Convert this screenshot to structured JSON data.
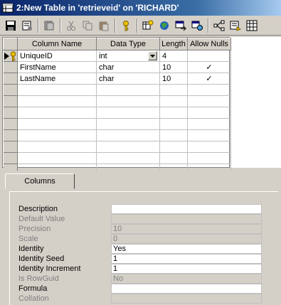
{
  "window": {
    "title": "2:New Table in 'retrieveid' on 'RICHARD'"
  },
  "toolbar": {
    "icons": [
      "save-icon",
      "properties-icon",
      "generate-script-icon",
      "cut-icon",
      "copy-icon",
      "paste-icon",
      "set-primary-key-icon",
      "table-designer-icon",
      "manage-indexes-icon",
      "manage-relationships-icon",
      "manage-constraints-icon",
      "relationship-diagram-icon",
      "manage-triggers-icon",
      "grid-icon"
    ]
  },
  "grid": {
    "headers": [
      "Column Name",
      "Data Type",
      "Length",
      "Allow Nulls"
    ],
    "rows": [
      {
        "name": "UniqueID",
        "type": "int",
        "length": "4",
        "allow_nulls": ""
      },
      {
        "name": "FirstName",
        "type": "char",
        "length": "10",
        "allow_nulls": "✓"
      },
      {
        "name": "LastName",
        "type": "char",
        "length": "10",
        "allow_nulls": "✓"
      }
    ]
  },
  "properties": {
    "tab_label": "Columns",
    "items": [
      {
        "label": "Description",
        "value": "",
        "enabled": true
      },
      {
        "label": "Default Value",
        "value": "",
        "enabled": false
      },
      {
        "label": "Precision",
        "value": "10",
        "enabled": false
      },
      {
        "label": "Scale",
        "value": "0",
        "enabled": false
      },
      {
        "label": "Identity",
        "value": "Yes",
        "enabled": true
      },
      {
        "label": "Identity Seed",
        "value": "1",
        "enabled": true
      },
      {
        "label": "Identity Increment",
        "value": "1",
        "enabled": true
      },
      {
        "label": "Is RowGuid",
        "value": "No",
        "enabled": false
      },
      {
        "label": "Formula",
        "value": "",
        "enabled": true
      },
      {
        "label": "Collation",
        "value": "",
        "enabled": false
      }
    ]
  }
}
